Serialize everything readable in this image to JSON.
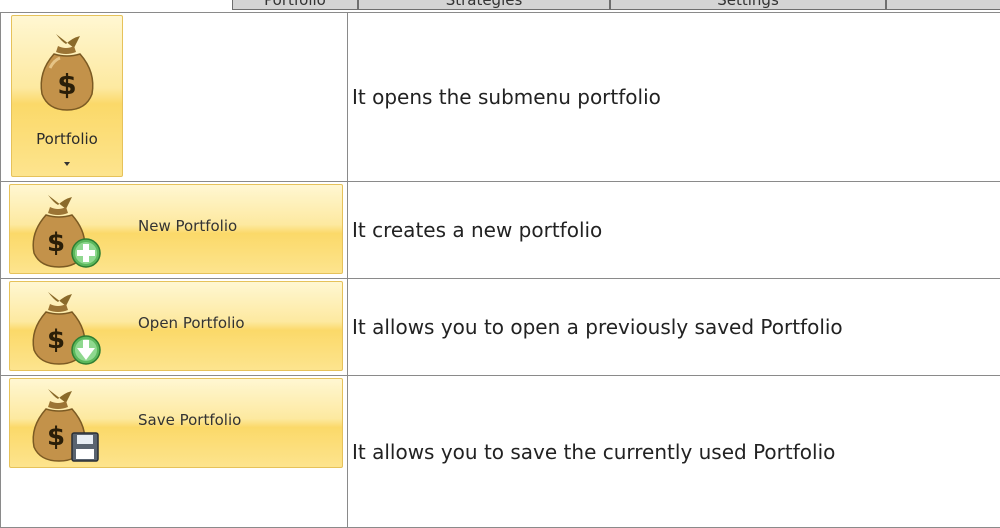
{
  "header": {
    "tabs": [
      "Portfolio",
      "Strategies",
      "Settings",
      ""
    ]
  },
  "rows": [
    {
      "button_label": "Portfolio",
      "description": "It opens the submenu portfolio",
      "icon": "money-bag-icon"
    },
    {
      "button_label": "New Portfolio",
      "description": "It creates a new portfolio",
      "icon": "money-bag-add-icon"
    },
    {
      "button_label": "Open Portfolio",
      "description": "It allows you to open a previously saved Portfolio",
      "icon": "money-bag-open-icon"
    },
    {
      "button_label": "Save Portfolio",
      "description": "It allows you to save the currently used Portfolio",
      "icon": "money-bag-save-icon"
    }
  ],
  "colors": {
    "button_gold": "#fbd969",
    "border": "#8a8a8a",
    "bag_brown": "#b88a3e",
    "badge_green": "#4caf50"
  }
}
